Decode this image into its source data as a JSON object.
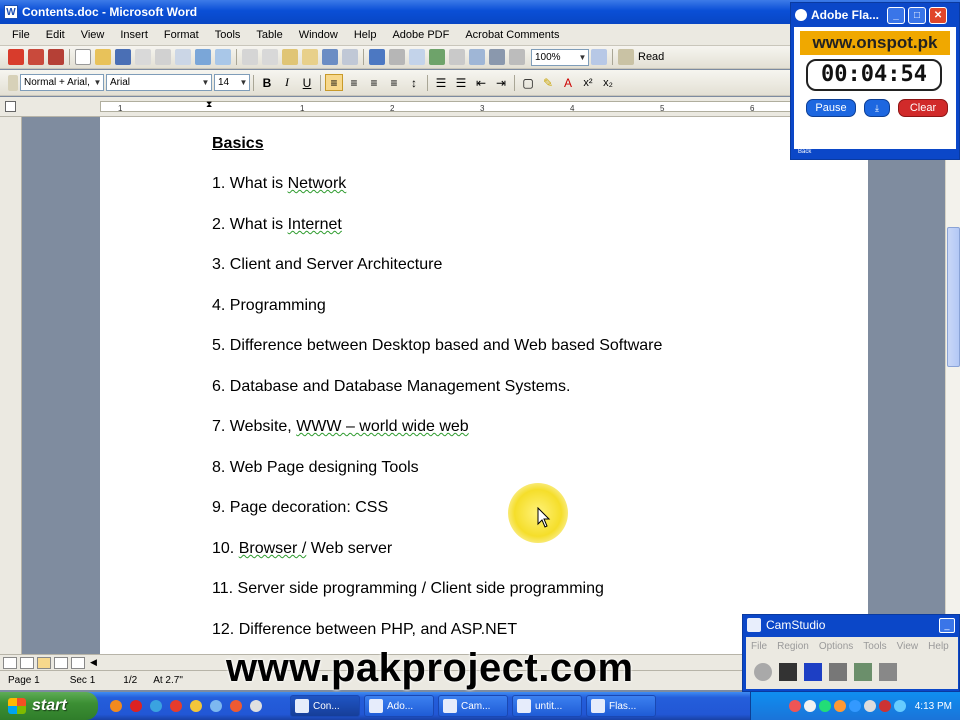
{
  "window": {
    "title": "Contents.doc - Microsoft Word"
  },
  "menu": [
    "File",
    "Edit",
    "View",
    "Insert",
    "Format",
    "Tools",
    "Table",
    "Window",
    "Help",
    "Adobe PDF",
    "Acrobat Comments"
  ],
  "toolbar": {
    "zoom": "100%",
    "read_label": "Read"
  },
  "formatting": {
    "style": "Normal + Arial,",
    "font": "Arial",
    "size": "14",
    "bold": "B",
    "italic": "I",
    "underline": "U"
  },
  "ruler": {
    "ticks": [
      "1",
      "1",
      "2",
      "3",
      "4",
      "5",
      "6"
    ]
  },
  "document": {
    "heading": "Basics",
    "items": [
      {
        "num": "1.",
        "pre": "What is ",
        "sq": "Network",
        "post": ""
      },
      {
        "num": "2.",
        "pre": "What is ",
        "sq": "Internet",
        "post": ""
      },
      {
        "num": "3.",
        "pre": "Client and Server Architecture",
        "sq": "",
        "post": ""
      },
      {
        "num": "4.",
        "pre": "Programming",
        "sq": "",
        "post": ""
      },
      {
        "num": "5.",
        "pre": "Difference between Desktop based and Web based Software",
        "sq": "",
        "post": ""
      },
      {
        "num": "6.",
        "pre": "Database and Database Management Systems.",
        "sq": "",
        "post": ""
      },
      {
        "num": "7.",
        "pre": "Website, ",
        "sq": "WWW – world wide web",
        "post": ""
      },
      {
        "num": "8.",
        "pre": "Web Page designing Tools",
        "sq": "",
        "post": ""
      },
      {
        "num": "9.",
        "pre": "Page decoration: CSS",
        "sq": "",
        "post": ""
      },
      {
        "num": "10.",
        "pre": "",
        "sq": "Browser  /",
        "post": "  Web server"
      },
      {
        "num": "11.",
        "pre": "Server side programming / Client side programming",
        "sq": "",
        "post": ""
      },
      {
        "num": "12.",
        "pre": " Difference between PHP, and ASP.NET",
        "sq": "",
        "post": ""
      }
    ]
  },
  "status": {
    "page": "Page 1",
    "sec": "Sec 1",
    "pages": "1/2",
    "at": "At 2.7\""
  },
  "watermark": "www.pakproject.com",
  "flash": {
    "title": "Adobe Fla...",
    "url": "www.onspot.pk",
    "timer": "00:04:54",
    "pause": "Pause",
    "clear": "Clear",
    "back": "Back"
  },
  "camstudio": {
    "title": "CamStudio",
    "menu": [
      "File",
      "Region",
      "Options",
      "Tools",
      "View",
      "Help"
    ]
  },
  "taskbar": {
    "start": "start",
    "tasks": [
      "Con...",
      "Ado...",
      "Cam...",
      "untit...",
      "Flas..."
    ],
    "clock": "4:13 PM"
  },
  "colors": {
    "accent": "#0a4fd6",
    "squiggle": "#2e9b2e",
    "highlight": "#f5de2a",
    "flash_url_bg": "#f0a800"
  }
}
